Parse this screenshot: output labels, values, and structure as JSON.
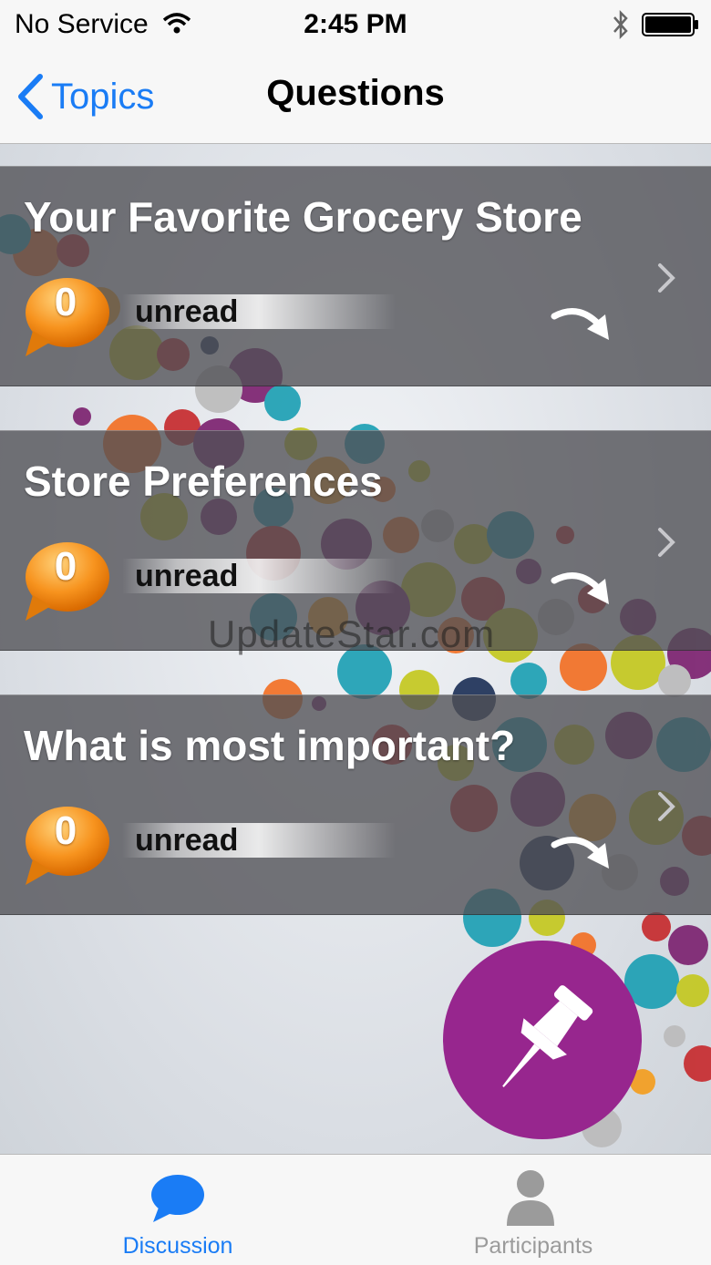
{
  "status_bar": {
    "carrier": "No Service",
    "time": "2:45 PM"
  },
  "nav": {
    "back_label": "Topics",
    "title": "Questions"
  },
  "rows": [
    {
      "title": "Your Favorite Grocery Store",
      "unread_count": "0",
      "unread_label": "unread"
    },
    {
      "title": "Store Preferences",
      "unread_count": "0",
      "unread_label": "unread"
    },
    {
      "title": "What is most important?",
      "unread_count": "0",
      "unread_label": "unread"
    }
  ],
  "watermark": "UpdateStar.com",
  "tabs": [
    {
      "label": "Discussion",
      "icon": "chat-bubble-icon",
      "selected": true
    },
    {
      "label": "Participants",
      "icon": "person-icon",
      "selected": false
    }
  ],
  "colors": {
    "accent": "#1a7cf5",
    "fab": "#97268e",
    "bubble": "#f7931e",
    "row_overlay": "#505054"
  }
}
